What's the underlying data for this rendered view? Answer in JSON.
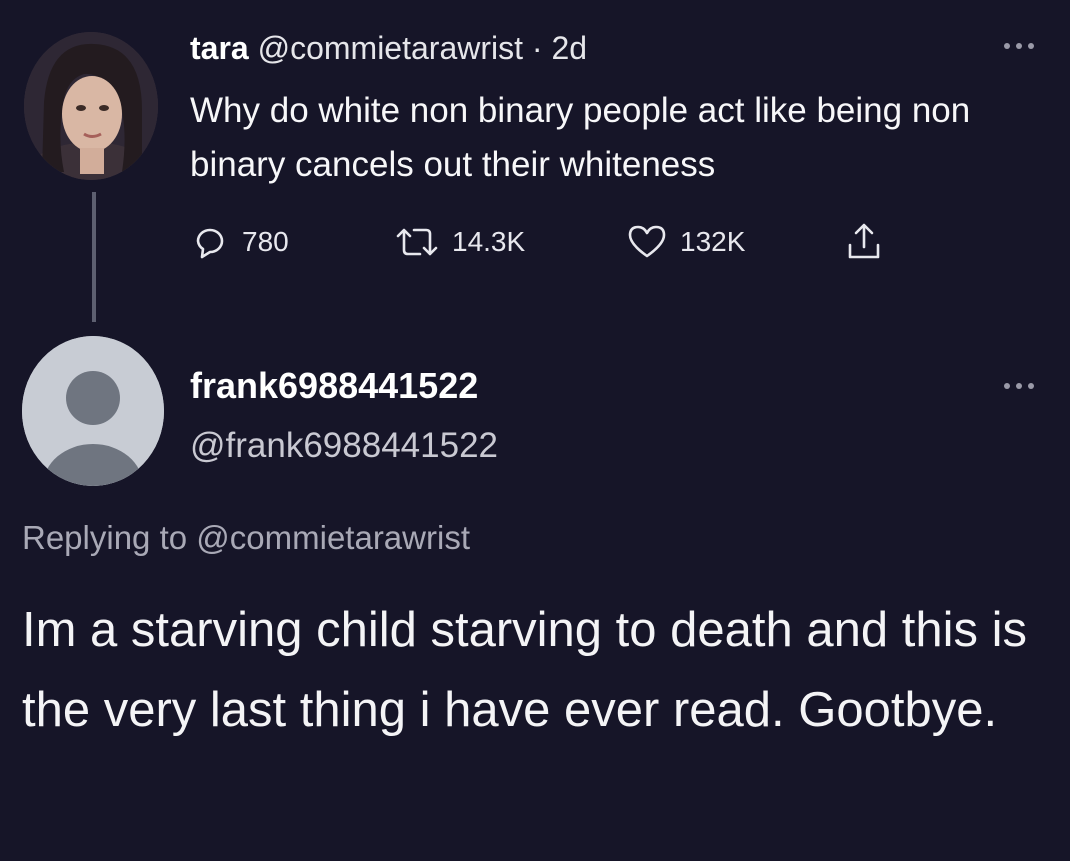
{
  "parent_tweet": {
    "author_name": "tara",
    "author_handle": "@commietarawrist",
    "age": "2d",
    "text": "Why do white non binary people act like being non binary cancels out their whiteness",
    "stats": {
      "replies": "780",
      "retweets": "14.3K",
      "likes": "132K"
    }
  },
  "reply_tweet": {
    "author_name": "frank6988441522",
    "author_handle": "@frank6988441522",
    "replying_to_label": "Replying to",
    "replying_to_handle": "@commietarawrist",
    "text": "Im a starving child starving to death and this is the very last thing i have ever read. Gootbye."
  },
  "icons": {
    "reply": "reply-icon",
    "retweet": "retweet-icon",
    "like": "heart-icon",
    "share": "share-icon",
    "more": "more-icon"
  },
  "colors": {
    "background": "#161528",
    "text": "#f2f2f5",
    "muted": "#a9a9b6"
  }
}
